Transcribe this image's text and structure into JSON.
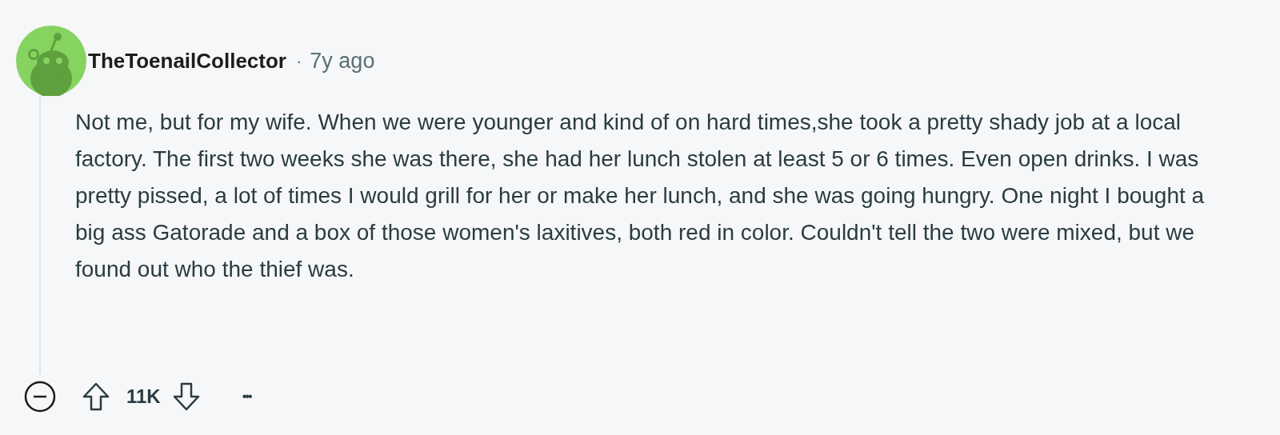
{
  "comment": {
    "author": "TheToenailCollector",
    "separator": "·",
    "time": "7y ago",
    "body": "Not me, but for my wife. When we were younger and kind of on hard times,she took a pretty shady job at a local factory. The first two weeks she was there, she had her lunch stolen at least 5 or 6 times. Even open drinks. I was pretty pissed, a lot of times I would grill for her or make her lunch, and she was going hungry. One night I bought a big ass Gatorade and a box of those women's laxitives, both red in color. Couldn't tell the two were mixed, but we found out who the thief was.",
    "score": "11K",
    "more": "•••"
  }
}
